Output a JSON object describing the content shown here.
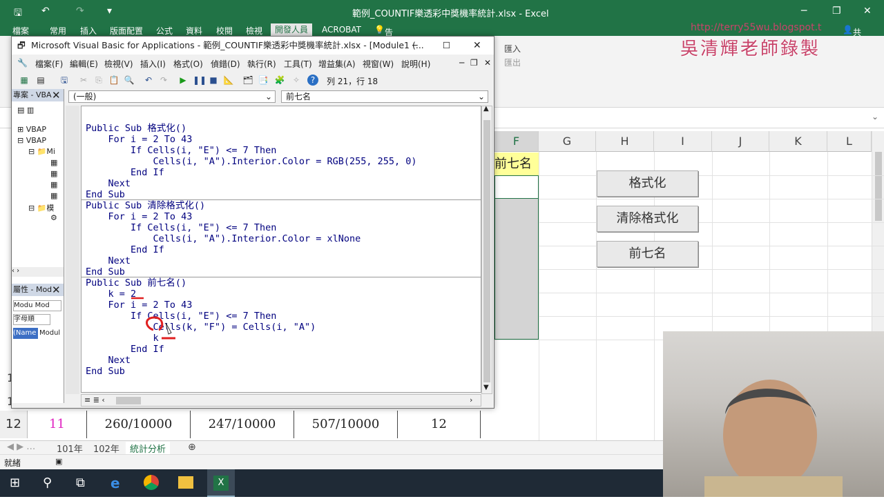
{
  "excel": {
    "title": "範例_COUNTIF樂透彩中獎機率統計.xlsx - Excel",
    "ribbon_tabs": [
      "檔案",
      "常用",
      "插入",
      "版面配置",
      "公式",
      "資料",
      "校閱",
      "檢視",
      "開發人員",
      "ACROBAT"
    ],
    "tell_me": "告訴我您想要執行的動作...",
    "share": "共用",
    "col_headers": [
      "F",
      "G",
      "H",
      "I",
      "J",
      "K",
      "L"
    ],
    "cell_f": "前七名",
    "buttons": [
      "格式化",
      "清除格式化",
      "前七名"
    ],
    "row12": {
      "row": "12",
      "a": "11",
      "b": "260/10000",
      "c": "247/10000",
      "d": "507/10000",
      "e": "12"
    },
    "row_numbers": [
      "1",
      "1"
    ],
    "sheet_tabs": [
      "101年",
      "102年",
      "統計分析"
    ],
    "status": "就緒",
    "ribbon_right": [
      "匯入",
      "匯出"
    ]
  },
  "vba": {
    "title": "Microsoft Visual Basic for Applications - 範例_COUNTIF樂透彩中獎機率統計.xlsx - [Module1 (...",
    "menu": [
      "檔案(F)",
      "編輯(E)",
      "檢視(V)",
      "插入(I)",
      "格式(O)",
      "偵錯(D)",
      "執行(R)",
      "工具(T)",
      "增益集(A)",
      "視窗(W)",
      "說明(H)"
    ],
    "cursor_pos": "列 21，行 18",
    "combo_object": "(一般)",
    "combo_proc": "前七名",
    "project_title": "專案 - VBA",
    "project_items": [
      "VBAP",
      "VBAP",
      "Mi",
      "模"
    ],
    "props_title": "屬性 - Mod",
    "props_combo": "Modu Mod",
    "props_tab": "字母順",
    "props_name": "(Name",
    "props_value": "Modul",
    "code_lines": [
      "Public Sub 格式化()",
      "    For i = 2 To 43",
      "        If Cells(i, \"E\") <= 7 Then",
      "            Cells(i, \"A\").Interior.Color = RGB(255, 255, 0)",
      "        End If",
      "    Next",
      "End Sub",
      "Public Sub 清除格式化()",
      "    For i = 2 To 43",
      "        If Cells(i, \"E\") <= 7 Then",
      "            Cells(i, \"A\").Interior.Color = xlNone",
      "        End If",
      "    Next",
      "End Sub",
      "Public Sub 前七名()",
      "    k = 2",
      "    For i = 2 To 43",
      "        If Cells(i, \"E\") <= 7 Then",
      "            Cells(k, \"F\") = Cells(i, \"A\")",
      "            k",
      "        End If",
      "    Next",
      "End Sub"
    ]
  },
  "overlay": {
    "blog": "http://terry55wu.blogspot.t",
    "watermark": "吳清輝老師錄製"
  }
}
